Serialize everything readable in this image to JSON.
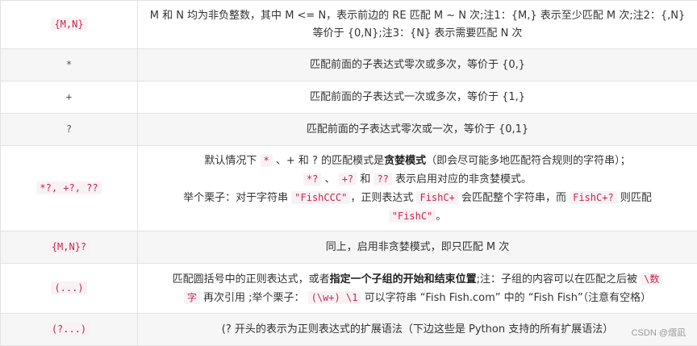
{
  "rows": [
    {
      "symbol": "{M,N}",
      "desc_parts": [
        {
          "t": "M 和 N 均为非负整数，其中 M <= N，表示前边的 RE 匹配 M ~ N 次;注1：{M,} 表示至少匹配 M 次;注2：{,N} 等价于 {0,N};注3：{N} 表示需要匹配 N 次"
        }
      ]
    },
    {
      "symbol": "*",
      "desc": "匹配前面的子表达式零次或多次，等价于 {0,}"
    },
    {
      "symbol": "+",
      "desc": "匹配前面的子表达式一次或多次，等价于 {1,}"
    },
    {
      "symbol": "?",
      "desc": "匹配前面的子表达式零次或一次，等价于 {0,1}"
    },
    {
      "symbol": "*?, +?, ??",
      "line1_a": "默认情况下",
      "line1_code": "*",
      "line1_b": "、+ 和 ? 的匹配模式是",
      "line1_bold": "贪婪模式",
      "line1_c": "（即会尽可能多地匹配符合规则的字符串）；",
      "line2_code1": "*?",
      "line2_sep1": "、",
      "line2_code2": "+?",
      "line2_sep2": "和",
      "line2_code3": "??",
      "line2_rest": "表示启用对应的非贪婪模式。",
      "line3_a": "举个栗子：对于字符串",
      "line3_code1": "\"FishCCC\"",
      "line3_b": "，正则表达式",
      "line3_code2": "FishC+",
      "line3_c": "会匹配整个字符串，而",
      "line3_code3": "FishC+?",
      "line3_d": "则匹配",
      "line4_code": "\"FishC\"",
      "line4_end": "。"
    },
    {
      "symbol": "{M,N}?",
      "desc": "同上，启用非贪婪模式，即只匹配 M 次"
    },
    {
      "symbol": "(...)",
      "l1_a": "匹配圆括号中的正则表达式，或者",
      "l1_bold": "指定一个子组的开始和结束位置",
      "l1_b": ";注：子组的内容可以在匹配之后被",
      "l1_code": "\\数",
      "l2_code": "字",
      "l2_a": "再次引用 ;举个栗子：",
      "l2_code2": "(\\w+) \\1",
      "l2_b": "可以字符串 “Fish Fish.com” 中的 “Fish Fish”（注意有空格）"
    },
    {
      "symbol": "(?...)",
      "desc": "(? 开头的表示为正则表达式的扩展语法（下边这些是 Python 支持的所有扩展语法）"
    }
  ],
  "watermark": "CSDN @熠凪"
}
